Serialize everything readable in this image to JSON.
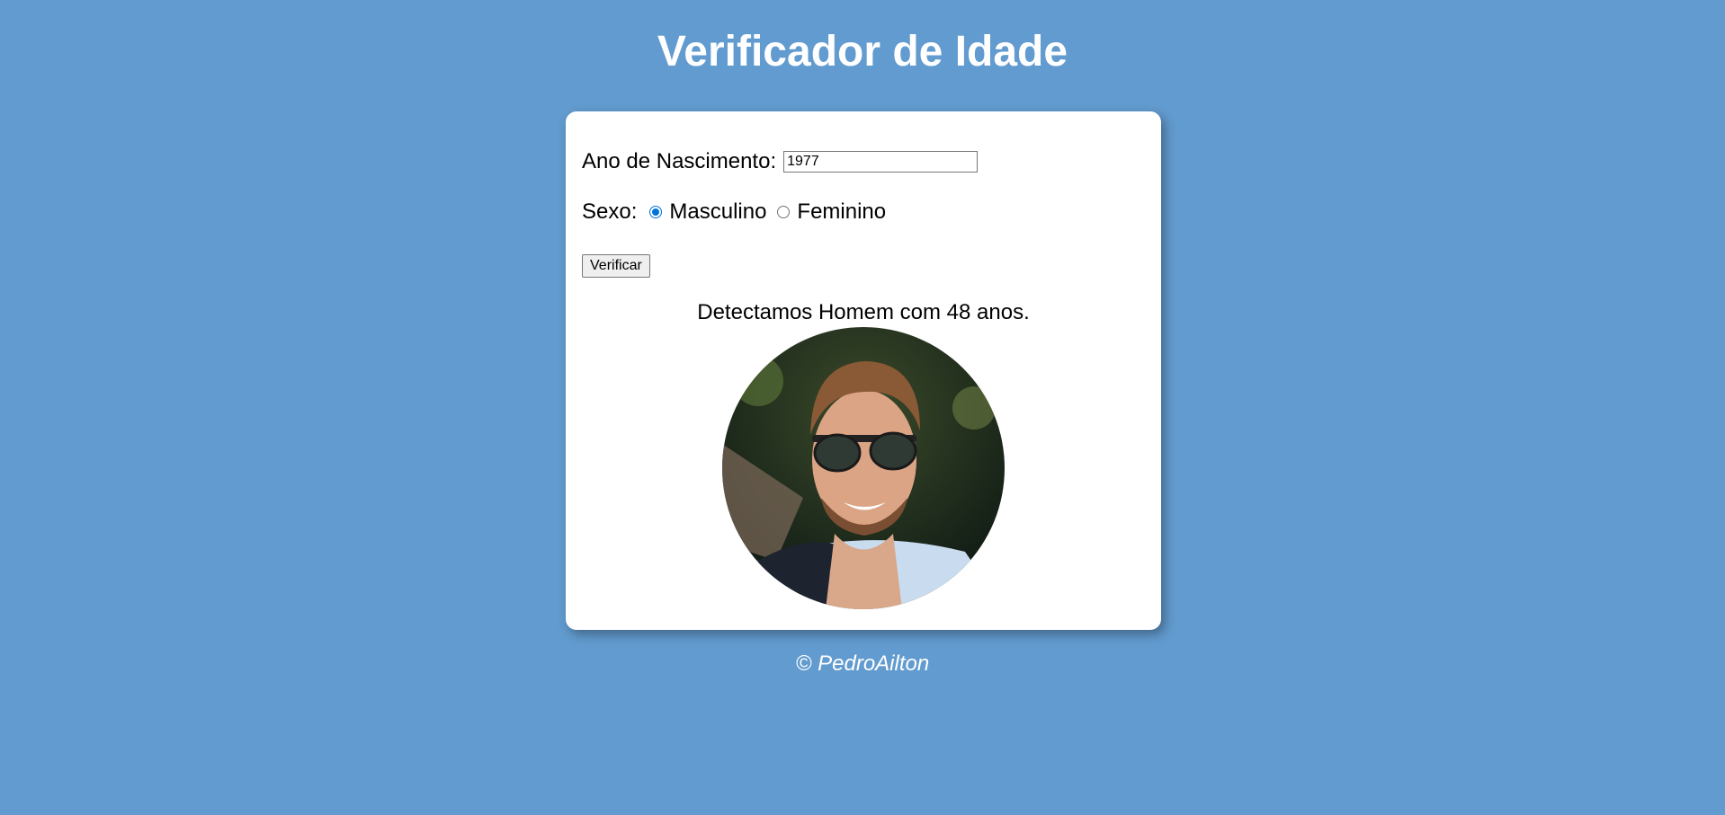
{
  "header": {
    "title": "Verificador de Idade"
  },
  "form": {
    "year_label": "Ano de Nascimento:",
    "year_value": "1977",
    "sex_label": "Sexo:",
    "options": [
      {
        "label": "Masculino",
        "checked": true
      },
      {
        "label": "Feminino",
        "checked": false
      }
    ],
    "submit_label": "Verificar"
  },
  "result": {
    "message": "Detectamos Homem com 48 anos.",
    "photo_icon": "man-with-sunglasses-photo"
  },
  "footer": {
    "text": "© PedroAilton"
  },
  "colors": {
    "background": "#629bcf",
    "card": "#ffffff",
    "radio_accent": "#0075d9"
  }
}
